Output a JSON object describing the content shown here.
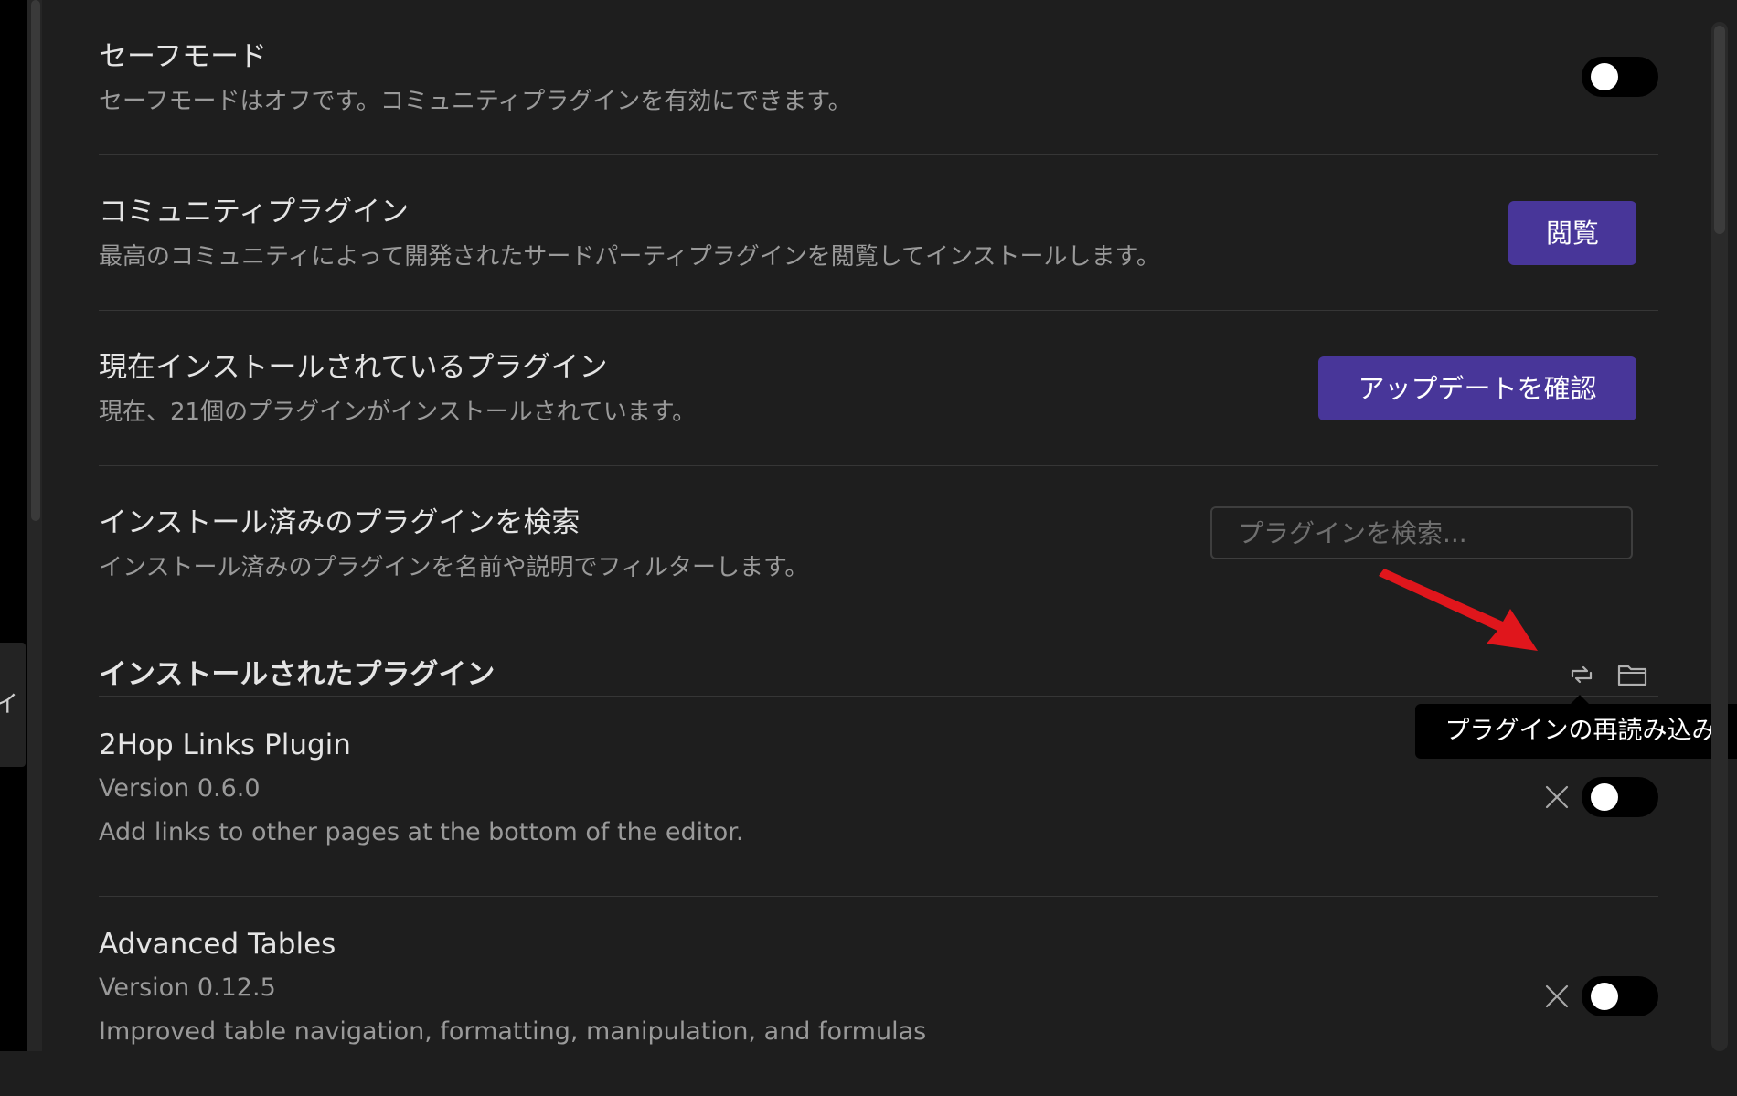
{
  "sidebar": {
    "edge_label": "イ"
  },
  "safe_mode": {
    "name": "セーフモード",
    "description": "セーフモードはオフです。コミュニティプラグインを有効にできます。",
    "toggle_on": false
  },
  "community_plugins": {
    "name": "コミュニティプラグイン",
    "description": "最高のコミュニティによって開発されたサードパーティプラグインを閲覧してインストールします。",
    "button_label": "閲覧"
  },
  "installed_plugins_setting": {
    "name": "現在インストールされているプラグイン",
    "description": "現在、21個のプラグインがインストールされています。",
    "button_label": "アップデートを確認"
  },
  "search_setting": {
    "name": "インストール済みのプラグインを検索",
    "description": "インストール済みのプラグインを名前や説明でフィルターします。",
    "placeholder": "プラグインを検索...",
    "value": ""
  },
  "installed_section": {
    "heading": "インストールされたプラグイン",
    "reload_icon": "reload-icon",
    "folder_icon": "folder-icon",
    "tooltip": "プラグインの再読み込み"
  },
  "plugins": [
    {
      "name": "2Hop Links Plugin",
      "version": "Version 0.6.0",
      "description": "Add links to other pages at the bottom of the editor.",
      "enabled": false
    },
    {
      "name": "Advanced Tables",
      "version": "Version 0.12.5",
      "description": "Improved table navigation, formatting, manipulation, and formulas",
      "enabled": false
    }
  ],
  "colors": {
    "accent": "#483699",
    "background": "#1e1e1e",
    "annotation_arrow": "#e0161c"
  }
}
